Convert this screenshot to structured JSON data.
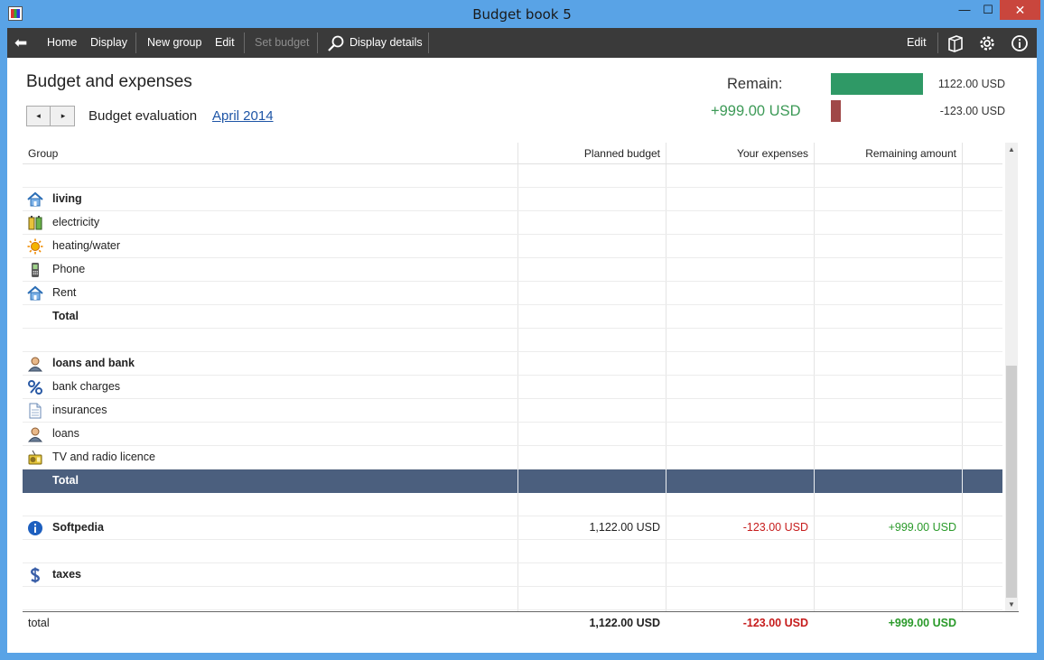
{
  "window": {
    "title": "Budget book 5",
    "min_glyph": "—",
    "max_glyph": "☐",
    "close_glyph": "✕"
  },
  "toolbar": {
    "back_glyph": "⬅",
    "home": "Home",
    "display": "Display",
    "new_group": "New group",
    "edit": "Edit",
    "set_budget": "Set budget",
    "display_details": "Display details",
    "edit_right": "Edit"
  },
  "page": {
    "heading": "Budget and expenses",
    "nav_prev": "◂",
    "nav_next": "▸",
    "eval_label": "Budget evaluation",
    "period": "April 2014"
  },
  "summary": {
    "remain_label": "Remain:",
    "remain_value": "+999.00 USD",
    "budget_bar_value": "1122.00 USD",
    "expense_bar_value": "-123.00 USD",
    "colors": {
      "budget_bar": "#2f9966",
      "expense_bar": "#a04848",
      "positive": "#2a9a2a",
      "negative": "#c61c1c",
      "selection": "#4b5f7e"
    }
  },
  "table": {
    "headers": {
      "group": "Group",
      "planned": "Planned budget",
      "expenses": "Your expenses",
      "remaining": "Remaining amount"
    },
    "rows": [
      {
        "name": "",
        "icon": "",
        "bold": false
      },
      {
        "name": "living",
        "icon": "house-icon",
        "bold": true
      },
      {
        "name": "electricity",
        "icon": "battery-icon",
        "bold": false
      },
      {
        "name": "heating/water",
        "icon": "sun-icon",
        "bold": false
      },
      {
        "name": "Phone",
        "icon": "phone-icon",
        "bold": false
      },
      {
        "name": "Rent",
        "icon": "house-icon",
        "bold": false
      },
      {
        "name": "Total",
        "icon": "",
        "bold": true
      },
      {
        "name": "",
        "icon": "",
        "bold": false
      },
      {
        "name": "loans and bank",
        "icon": "person-icon",
        "bold": true
      },
      {
        "name": "bank charges",
        "icon": "percent-icon",
        "bold": false
      },
      {
        "name": "insurances",
        "icon": "document-icon",
        "bold": false
      },
      {
        "name": "loans",
        "icon": "person-icon",
        "bold": false
      },
      {
        "name": "TV and radio licence",
        "icon": "radio-icon",
        "bold": false
      },
      {
        "name": "Total",
        "icon": "",
        "bold": true,
        "selected": true
      },
      {
        "name": "",
        "icon": "",
        "bold": false
      },
      {
        "name": "Softpedia",
        "icon": "info-icon",
        "bold": true,
        "planned": "1,122.00 USD",
        "expenses": "-123.00 USD",
        "remaining": "+999.00 USD"
      },
      {
        "name": "",
        "icon": "",
        "bold": false
      },
      {
        "name": "taxes",
        "icon": "dollar-icon",
        "bold": true
      },
      {
        "name": "",
        "icon": "",
        "bold": false
      }
    ],
    "total": {
      "label": "total",
      "planned": "1,122.00 USD",
      "expenses": "-123.00 USD",
      "remaining": "+999.00 USD"
    },
    "scroll_up_glyph": "▲",
    "scroll_down_glyph": "▼"
  }
}
